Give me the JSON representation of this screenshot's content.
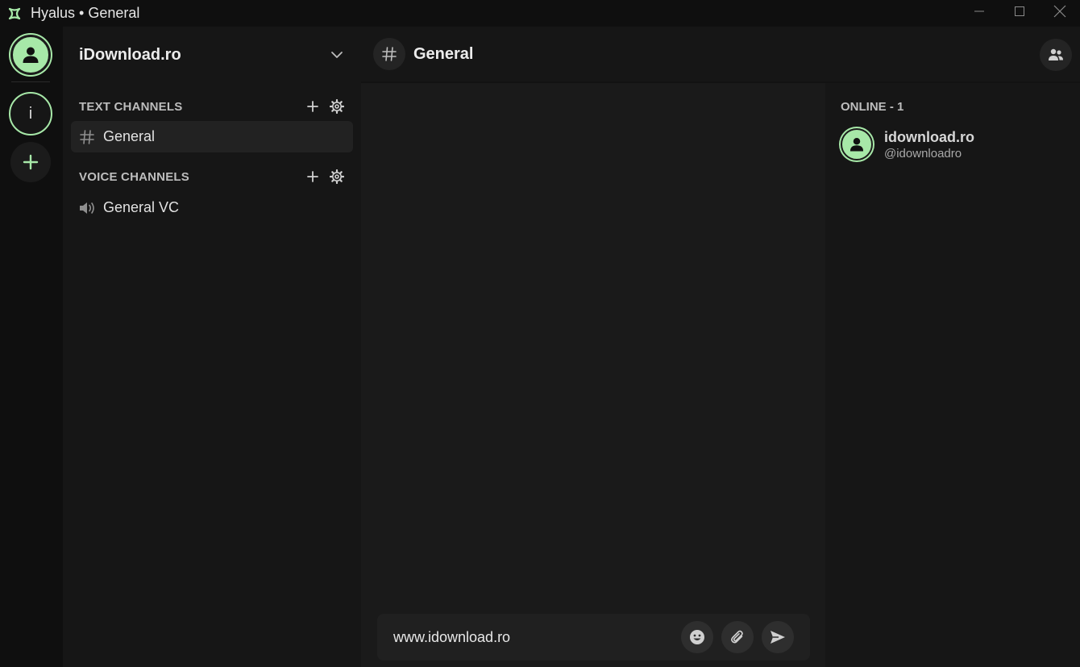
{
  "window": {
    "title": "Hyalus • General",
    "controls": [
      "minimize",
      "maximize",
      "close"
    ]
  },
  "colors": {
    "accent": "#a7e8a8",
    "background": "#161616",
    "chat_background": "#1a1a1a",
    "titlebar": "#0f0f0f"
  },
  "rail": {
    "user_avatar_icon": "user-icon",
    "server_initial": "i",
    "add_server_icon": "plus-icon"
  },
  "sidebar": {
    "server_name": "iDownload.ro",
    "text_category": "TEXT CHANNELS",
    "voice_category": "VOICE CHANNELS",
    "text_channels": [
      {
        "name": "General",
        "icon": "hash-icon",
        "active": true
      }
    ],
    "voice_channels": [
      {
        "name": "General VC",
        "icon": "speaker-icon"
      }
    ]
  },
  "chat": {
    "channel_name": "General",
    "composer_value": "www.idownload.ro",
    "composer_buttons": [
      "emoji-icon",
      "attachment-icon",
      "send-icon"
    ]
  },
  "members": {
    "category": "ONLINE - 1",
    "list": [
      {
        "name": "idownload.ro",
        "handle": "@idownloadro"
      }
    ]
  }
}
